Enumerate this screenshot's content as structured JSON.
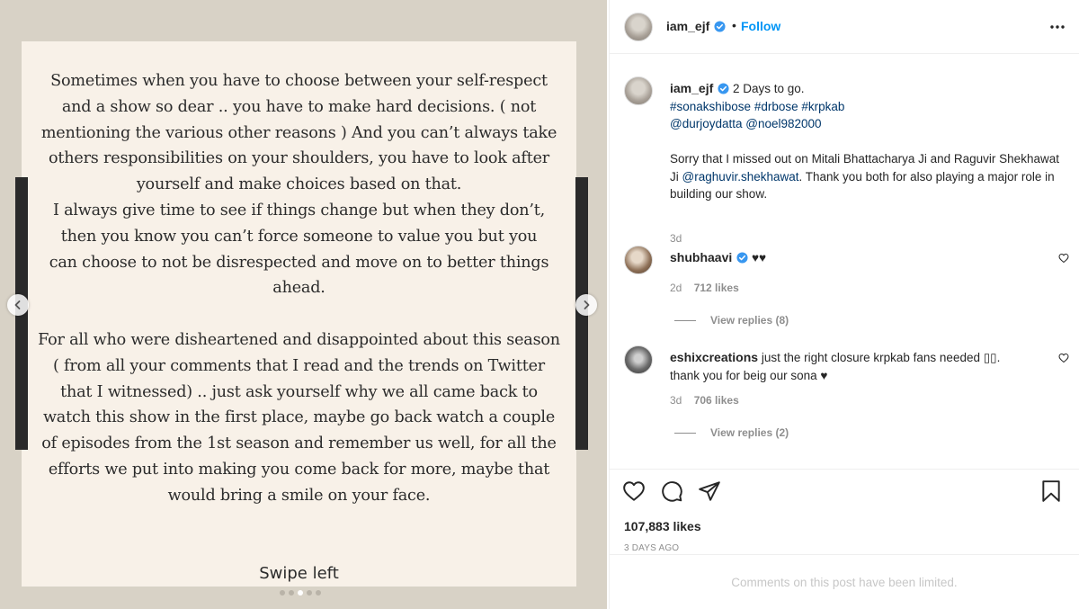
{
  "post": {
    "slide_lines_1": [
      "Sometimes when you have to choose between your self-respect",
      "and a show so dear .. you have to make hard decisions. ( not",
      "mentioning the various other reasons ) And you can’t always take",
      "others responsibilities on your shoulders, you have to look after",
      "yourself and make choices based on that.",
      "I always give time to see if things change but when they don’t,",
      "then you know you can’t force someone to value you but you",
      "can choose to not be disrespected and move on to better things",
      "ahead."
    ],
    "slide_lines_2": [
      "For all who were disheartened and disappointed about this season",
      "( from all your comments that I read and the trends on Twitter",
      "that I witnessed) .. just ask yourself why we all came back to",
      "watch this show in the first place, maybe go back watch a couple",
      "of episodes from the 1st season and remember us well, for all the",
      "efforts we put into making you come back for more, maybe that",
      "would bring a smile on your face."
    ],
    "swipe_label": "Swipe left",
    "carousel_count": 5,
    "carousel_active": 3
  },
  "header": {
    "username": "iam_ejf",
    "separator": "•",
    "follow_label": "Follow"
  },
  "caption": {
    "username": "iam_ejf",
    "text": "2 Days to go.",
    "hashtags": "#sonakshibose #drbose #krpkab",
    "mentions": "@durjoydatta @noel982000",
    "body_part1": "Sorry that I missed out on Mitali Bhattacharya Ji and Raguvir Shekhawat Ji ",
    "body_mention": "@raghuvir.shekhawat",
    "body_part2": ". Thank you both for also playing a major role in building our show.",
    "time": "3d"
  },
  "comments": [
    {
      "username": "shubhaavi",
      "text": "♥♥",
      "time": "2d",
      "likes": "712 likes",
      "view_replies": "View replies (8)"
    },
    {
      "username": "eshixcreations",
      "text": "just the right closure krpkab fans needed ▯▯.",
      "text2": "thank you for beig our sona ♥",
      "time": "3d",
      "likes": "706 likes",
      "view_replies": "View replies (2)"
    }
  ],
  "actions": {
    "likes_total": "107,883 likes",
    "date": "3 DAYS AGO",
    "comments_limited": "Comments on this post have been limited."
  },
  "colors": {
    "link": "#00376b",
    "follow": "#0095f6",
    "verified": "#3897f0"
  },
  "icons": [
    "verified-icon",
    "more-options-icon",
    "heart-icon",
    "comment-icon",
    "share-icon",
    "bookmark-icon",
    "chevron-left-icon",
    "chevron-right-icon"
  ]
}
